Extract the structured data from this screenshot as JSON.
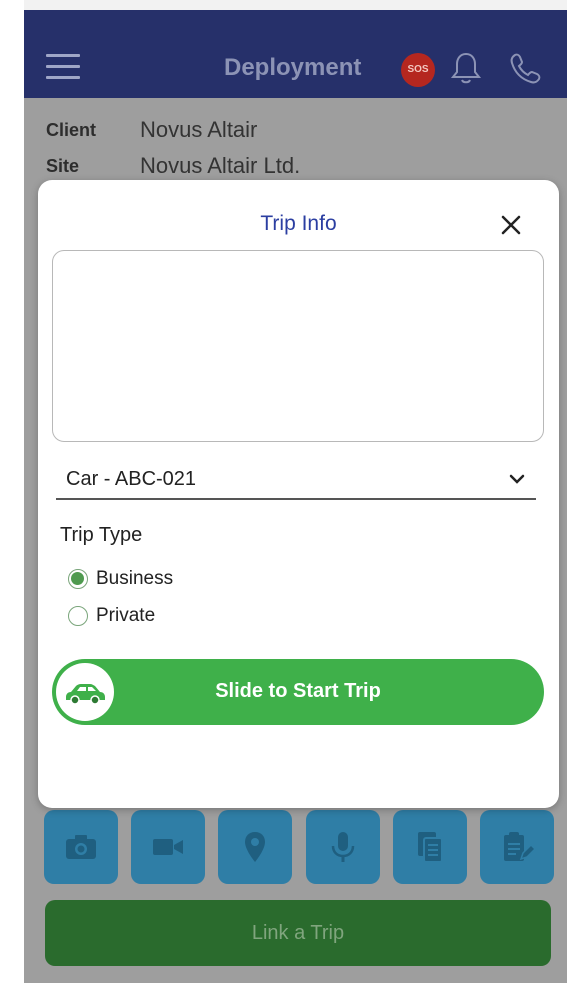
{
  "header": {
    "title": "Deployment",
    "sos_label": "SOS"
  },
  "info": [
    {
      "label": "Client",
      "value": "Novus Altair"
    },
    {
      "label": "Site",
      "value": "Novus Altair Ltd."
    }
  ],
  "modal": {
    "title": "Trip Info",
    "notes_value": "",
    "vehicle_selected": "Car - ABC-021",
    "trip_type_label": "Trip Type",
    "trip_types": [
      {
        "label": "Business",
        "checked": true
      },
      {
        "label": "Private",
        "checked": false
      }
    ],
    "slider_label": "Slide to Start Trip"
  },
  "tools": [
    "camera-icon",
    "video-icon",
    "location-icon",
    "microphone-icon",
    "documents-icon",
    "clipboard-edit-icon"
  ],
  "link_trip_label": "Link a Trip",
  "colors": {
    "header_bg": "#26306a",
    "accent_green": "#3fb04a",
    "tool_bg": "#2f7ea6",
    "title_blue": "#2b3ea1"
  }
}
